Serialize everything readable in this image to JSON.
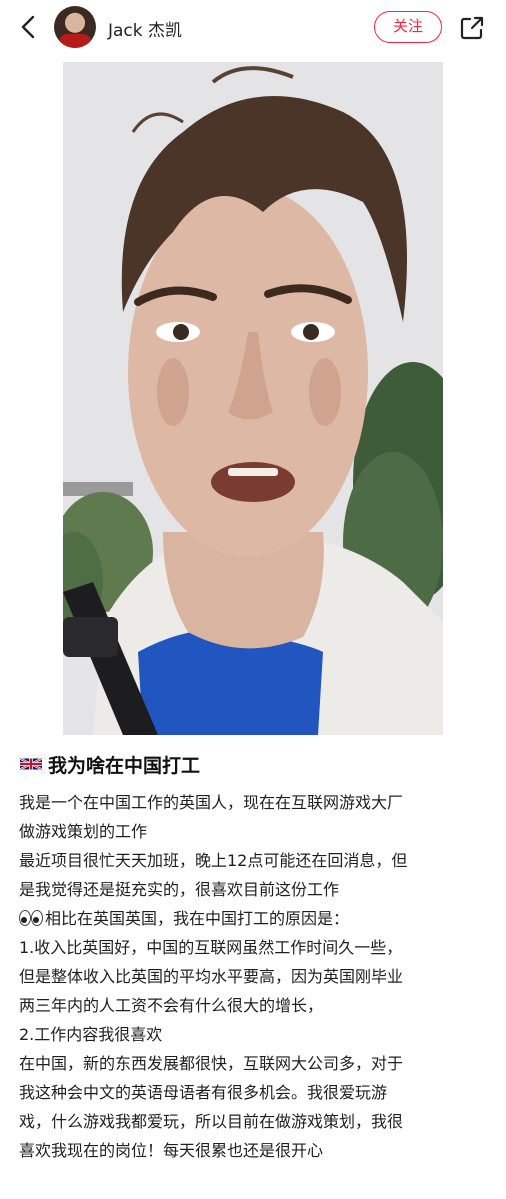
{
  "header": {
    "username": "Jack 杰凯",
    "follow_label": "关注"
  },
  "icons": {
    "back": "chevron-left-icon",
    "share": "share-icon",
    "flag": "uk-flag-icon",
    "eyes": "eyes-emoji-icon"
  },
  "colors": {
    "accent": "#ff2442",
    "text": "#1f1f1f"
  },
  "post": {
    "title": "我为啥在中国打工",
    "lines": [
      "我是一个在中国工作的英国人，现在在互联网游戏大厂",
      "做游戏策划的工作",
      "最近项目很忙天天加班，晚上12点可能还在回消息，但",
      "是我觉得还是挺充实的，很喜欢目前这份工作",
      "相比在英国英国，我在中国打工的原因是：",
      "1.收入比英国好，中国的互联网虽然工作时间久一些，",
      "但是整体收入比英国的平均水平要高，因为英国刚毕业",
      "两三年内的人工资不会有什么很大的增长，",
      "2.工作内容我很喜欢",
      "在中国，新的东西发展都很快，互联网大公司多，对于",
      "我这种会中文的英语母语者有很多机会。我很爱玩游",
      "戏，什么游戏我都爱玩，所以目前在做游戏策划，我很",
      "喜欢我现在的岗位！每天很累也还是很开心"
    ]
  }
}
